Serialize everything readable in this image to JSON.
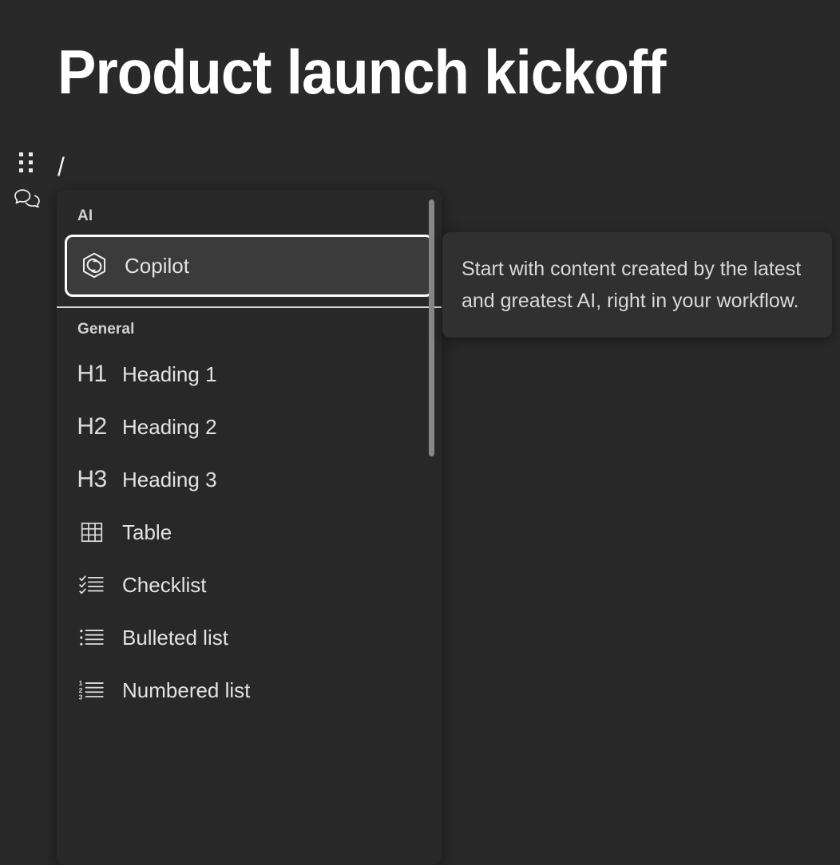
{
  "document": {
    "title": "Product launch kickoff",
    "editor_line_text": "/"
  },
  "gutter": {
    "drag_handle_icon": "drag-handle-dots-icon",
    "comment_icon": "comment-bubbles-icon"
  },
  "slash_menu": {
    "groups": [
      {
        "label": "AI",
        "items": [
          {
            "label": "Copilot",
            "icon": "copilot-hexagon-icon",
            "selected": true
          }
        ]
      },
      {
        "label": "General",
        "items": [
          {
            "label": "Heading 1",
            "icon": "h1-icon"
          },
          {
            "label": "Heading 2",
            "icon": "h2-icon"
          },
          {
            "label": "Heading 3",
            "icon": "h3-icon"
          },
          {
            "label": "Table",
            "icon": "table-grid-icon"
          },
          {
            "label": "Checklist",
            "icon": "checklist-icon"
          },
          {
            "label": "Bulleted list",
            "icon": "bulleted-list-icon"
          },
          {
            "label": "Numbered list",
            "icon": "numbered-list-icon"
          }
        ]
      }
    ],
    "scrollbar": {
      "visible": true
    }
  },
  "tooltip": {
    "text": "Start with content created by the latest and greatest AI, right in your workflow."
  },
  "colors": {
    "page_background": "#292929",
    "menu_background": "#282828",
    "selected_row_background": "#3b3b3b",
    "focus_ring": "#ffffff",
    "tooltip_background": "#303030",
    "primary_text": "#ffffff",
    "secondary_text": "#d8d8d8",
    "scrollbar_thumb": "#888888"
  }
}
